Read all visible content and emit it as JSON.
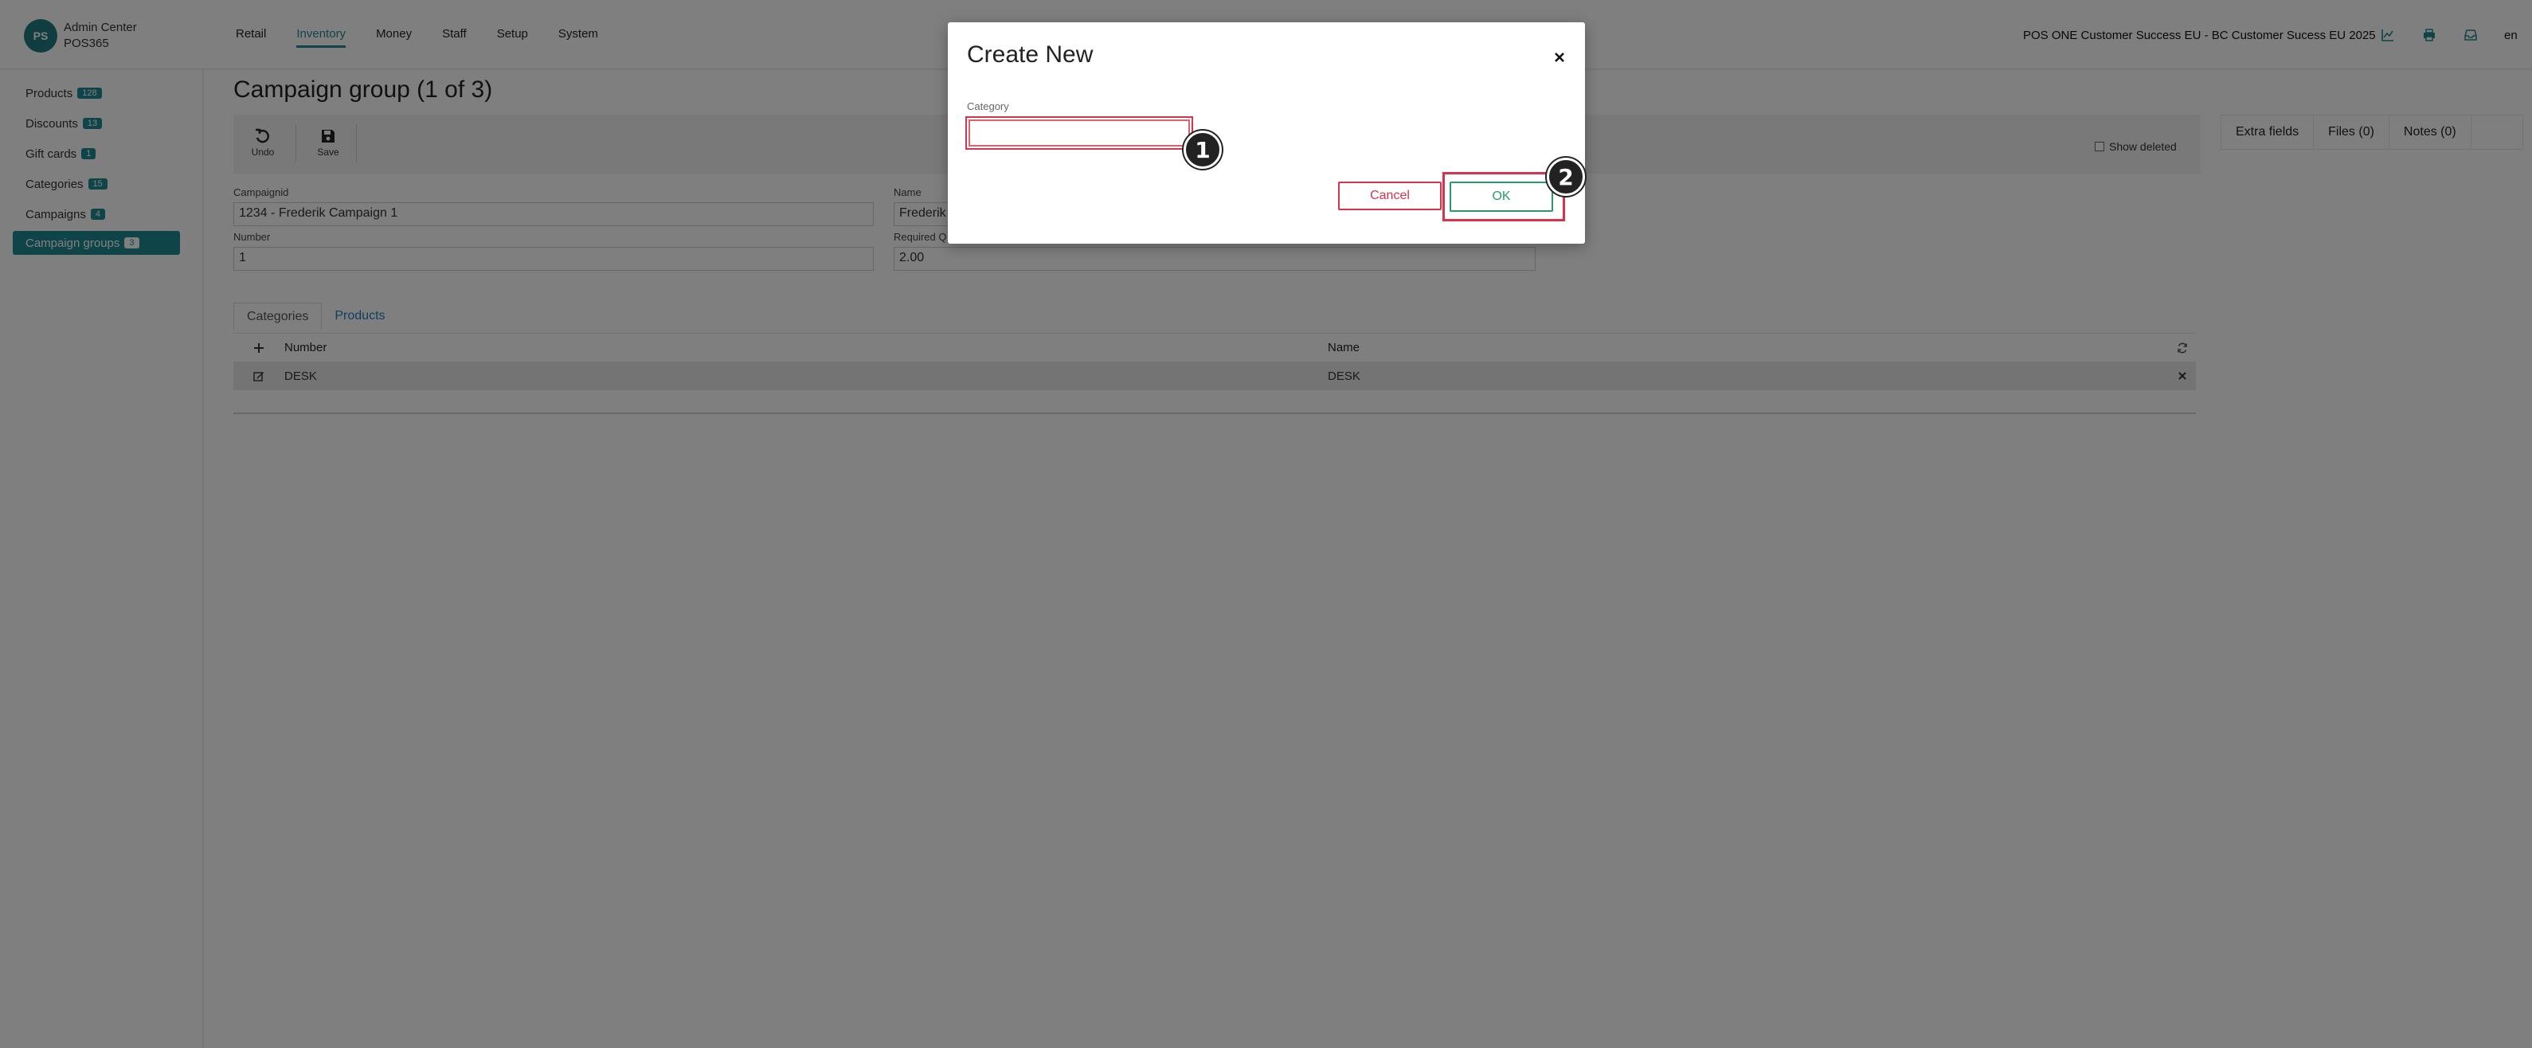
{
  "header": {
    "avatar_initials": "PS",
    "app_name": "Admin Center",
    "app_sub": "POS365",
    "nav": [
      "Retail",
      "Inventory",
      "Money",
      "Staff",
      "Setup",
      "System"
    ],
    "active_nav": "Inventory",
    "org": "POS ONE Customer Success EU - BC Customer Sucess EU 2025",
    "icons": [
      "chart-icon",
      "print-icon",
      "inbox-icon"
    ],
    "lang": "en"
  },
  "sidebar": {
    "items": [
      {
        "label": "Products",
        "count": "128"
      },
      {
        "label": "Discounts",
        "count": "13"
      },
      {
        "label": "Gift cards",
        "count": "1"
      },
      {
        "label": "Categories",
        "count": "15"
      },
      {
        "label": "Campaigns",
        "count": "4"
      },
      {
        "label": "Campaign groups",
        "count": "3"
      }
    ],
    "active": "Campaign groups"
  },
  "main": {
    "title": "Campaign group (1 of 3)",
    "toolbar": {
      "undo": "Undo",
      "save": "Save",
      "show_deleted": "Show deleted"
    },
    "right_tabs": [
      "Extra fields",
      "Files (0)",
      "Notes (0)"
    ],
    "form": {
      "campaignid_label": "Campaignid",
      "campaignid_value": "1234 - Frederik Campaign 1",
      "name_label": "Name",
      "name_value": "Frederik",
      "number_label": "Number",
      "number_value": "1",
      "required_label": "Required Q",
      "required_value": "2.00"
    },
    "content_tabs": [
      "Categories",
      "Products"
    ],
    "grid": {
      "columns": [
        "Number",
        "Name"
      ],
      "rows": [
        {
          "number": "DESK",
          "name": "DESK"
        }
      ]
    }
  },
  "modal": {
    "title": "Create New",
    "category_label": "Category",
    "category_value": "",
    "cancel": "Cancel",
    "ok": "OK",
    "markers": [
      "1",
      "2"
    ]
  },
  "colors": {
    "accent": "#1f8a90",
    "danger": "#d8334a",
    "ok": "#2a9a6a"
  }
}
